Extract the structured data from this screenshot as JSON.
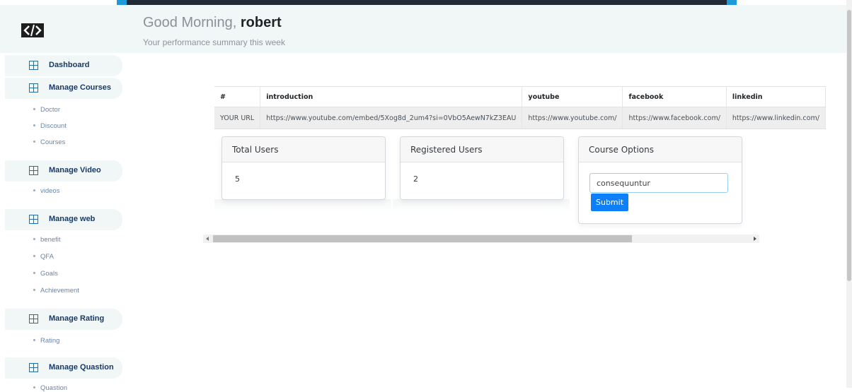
{
  "header": {
    "greeting_prefix": "Good Morning, ",
    "user_name": "robert",
    "subtitle": "Your performance summary this week"
  },
  "sidebar": {
    "sections": [
      {
        "label": "Dashboard",
        "items": []
      },
      {
        "label": "Manage Courses",
        "items": [
          "Doctor",
          "Discount",
          "Courses"
        ]
      },
      {
        "label": "Manage Video",
        "items": [
          "videos"
        ]
      },
      {
        "label": "Manage web",
        "items": [
          "benefit",
          "QFA",
          "Goals",
          "Achievement"
        ]
      },
      {
        "label": "Manage Rating",
        "items": [
          "Rating"
        ]
      },
      {
        "label": "Manage Quastion",
        "items": [
          "Quastion"
        ]
      }
    ]
  },
  "links_table": {
    "headers": [
      "#",
      "introduction",
      "youtube",
      "facebook",
      "linkedin"
    ],
    "row": [
      "YOUR URL",
      "https://www.youtube.com/embed/5Xog8d_2um4?si=0VbO5AewN7kZ3EAU",
      "https://www.youtube.com/",
      "https://www.facebook.com/",
      "https://www.linkedin.com/"
    ]
  },
  "cards": {
    "total_users": {
      "title": "Total Users",
      "value": "5"
    },
    "registered_users": {
      "title": "Registered Users",
      "value": "2"
    },
    "course_options": {
      "title": "Course Options",
      "input_value": "consequuntur",
      "submit_label": "Submit"
    }
  },
  "colors": {
    "accent": "#0d7ff8",
    "header_bg": "#f1f6f7",
    "nav_text": "#1b3a63"
  }
}
